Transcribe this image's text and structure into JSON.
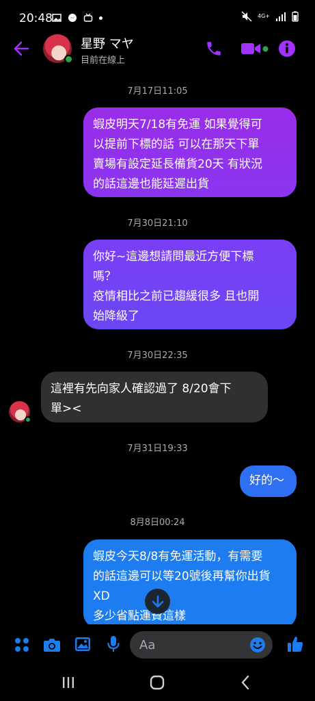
{
  "status_bar": {
    "time": "20:48",
    "network": "4G+"
  },
  "header": {
    "contact_name": "星野 マヤ",
    "presence": "目前在線上"
  },
  "messages": [
    {
      "timestamp": "7月17日11:05",
      "direction": "outgoing",
      "text": "蝦皮明天7/18有免運 如果覺得可\n以提前下標的話 可以在那天下單\n賣場有設定延長備貨20天 有狀況\n的話這邊也能延遲出貨"
    },
    {
      "timestamp": "7月30日21:10",
      "direction": "outgoing",
      "text": "你好~這邊想請問最近方便下標\n嗎？\n疫情相比之前已趨緩很多 且也開\n始降級了"
    },
    {
      "timestamp": "7月30日22:35",
      "direction": "incoming",
      "text": "這裡有先向家人確認過了 8/20會下\n單><"
    },
    {
      "timestamp": "7月31日19:33",
      "direction": "outgoing",
      "text": "好的～"
    },
    {
      "timestamp": "8月8日00:24",
      "direction": "outgoing",
      "text": "蝦皮今天8/8有免運活動，有需要\n的話這邊可以等20號後再幫你出貨\nXD\n多少省點運費這樣"
    }
  ],
  "composer": {
    "placeholder": "Aa"
  },
  "colors": {
    "accent": "#a033ff",
    "blue": "#1c7cf0",
    "online": "#31a24c"
  },
  "icons": [
    "back-arrow-icon",
    "phone-icon",
    "video-icon",
    "info-icon",
    "menu-dots-icon",
    "camera-icon",
    "gallery-icon",
    "mic-icon",
    "emoji-icon",
    "like-icon",
    "scroll-down-icon"
  ]
}
